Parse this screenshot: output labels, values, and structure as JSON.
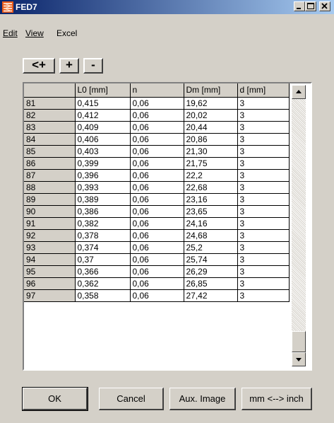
{
  "window": {
    "title": "FED7",
    "icon": "spring-icon"
  },
  "menu": [
    "Edit",
    "View",
    "Excel"
  ],
  "toolbar": {
    "insert_before_label": "<+",
    "add_label": "+",
    "remove_label": "-"
  },
  "grid": {
    "columns": [
      "",
      "L0 [mm]",
      "n",
      "Dm [mm]",
      "d [mm]"
    ],
    "rows": [
      [
        "81",
        "0,415",
        "0,06",
        "19,62",
        "3"
      ],
      [
        "82",
        "0,412",
        "0,06",
        "20,02",
        "3"
      ],
      [
        "83",
        "0,409",
        "0,06",
        "20,44",
        "3"
      ],
      [
        "84",
        "0,406",
        "0,06",
        "20,86",
        "3"
      ],
      [
        "85",
        "0,403",
        "0,06",
        "21,30",
        "3"
      ],
      [
        "86",
        "0,399",
        "0,06",
        "21,75",
        "3"
      ],
      [
        "87",
        "0,396",
        "0,06",
        "22,2",
        "3"
      ],
      [
        "88",
        "0,393",
        "0,06",
        "22,68",
        "3"
      ],
      [
        "89",
        "0,389",
        "0,06",
        "23,16",
        "3"
      ],
      [
        "90",
        "0,386",
        "0,06",
        "23,65",
        "3"
      ],
      [
        "91",
        "0,382",
        "0,06",
        "24,16",
        "3"
      ],
      [
        "92",
        "0,378",
        "0,06",
        "24,68",
        "3"
      ],
      [
        "93",
        "0,374",
        "0,06",
        "25,2",
        "3"
      ],
      [
        "94",
        "0,37",
        "0,06",
        "25,74",
        "3"
      ],
      [
        "95",
        "0,366",
        "0,06",
        "26,29",
        "3"
      ],
      [
        "96",
        "0,362",
        "0,06",
        "26,85",
        "3"
      ],
      [
        "97",
        "0,358",
        "0,06",
        "27,42",
        "3"
      ]
    ]
  },
  "buttons": {
    "ok": "OK",
    "cancel": "Cancel",
    "aux_image": "Aux. Image",
    "units": "mm <--> inch"
  }
}
